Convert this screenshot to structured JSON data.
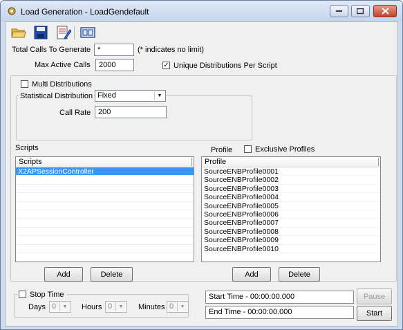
{
  "window": {
    "title": "Load Generation - LoadGendefault",
    "icon": "gear-icon"
  },
  "toolbar": {
    "icons": [
      "open-folder-icon",
      "save-icon",
      "edit-icon",
      "film-icon"
    ]
  },
  "settings": {
    "total_calls_label": "Total Calls To Generate",
    "total_calls_value": "*",
    "total_calls_hint": "(* indicates no limit)",
    "max_active_label": "Max Active Calls",
    "max_active_value": "2000",
    "unique_dist_label": "Unique Distributions Per Script",
    "unique_dist_checked": true
  },
  "distribution": {
    "multi_label": "Multi Distributions",
    "multi_checked": false,
    "stat_label": "Statistical Distribution",
    "stat_value": "Fixed",
    "call_rate_label": "Call Rate",
    "call_rate_value": "200"
  },
  "scripts": {
    "section_label": "Scripts",
    "column_header": "Scripts",
    "items": [
      "X2APSessionController"
    ],
    "add_label": "Add",
    "delete_label": "Delete"
  },
  "profiles": {
    "section_label": "Profile",
    "exclusive_label": "Exclusive Profiles",
    "exclusive_checked": false,
    "column_header": "Profile",
    "items": [
      "SourceENBProfile0001",
      "SourceENBProfile0002",
      "SourceENBProfile0003",
      "SourceENBProfile0004",
      "SourceENBProfile0005",
      "SourceENBProfile0006",
      "SourceENBProfile0007",
      "SourceENBProfile0008",
      "SourceENBProfile0009",
      "SourceENBProfile0010"
    ],
    "add_label": "Add",
    "delete_label": "Delete"
  },
  "stop_time": {
    "label": "Stop Time",
    "checked": false,
    "days_label": "Days",
    "days_value": "0",
    "hours_label": "Hours",
    "hours_value": "0",
    "minutes_label": "Minutes",
    "minutes_value": "0"
  },
  "timing": {
    "start_time": "Start Time - 00:00:00.000",
    "end_time": "End Time  - 00:00:00.000",
    "pause_label": "Pause",
    "start_label": "Start"
  }
}
